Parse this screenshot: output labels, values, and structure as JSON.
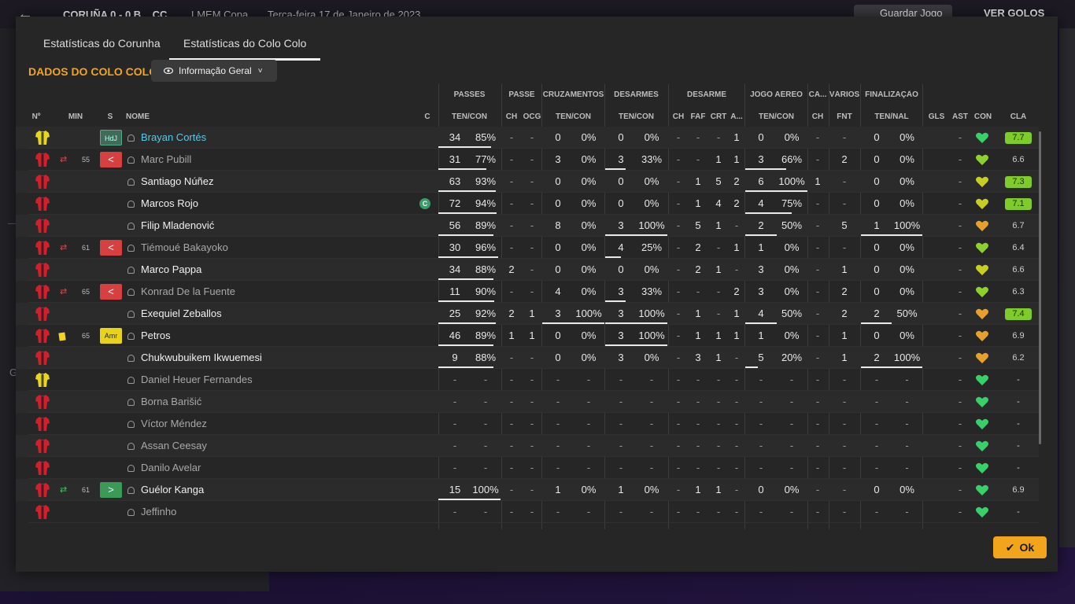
{
  "background": {
    "back_glyph": "←",
    "score_text": "CORUÑA 0 - 0 B... CC",
    "competition": "LMEM Copa",
    "date": "Terça-feira 17 de Janeiro de 2023",
    "save_button": "Guardar Jogo",
    "watch_button": "VER GOLOS",
    "side_letter": "G"
  },
  "tabs": [
    "Estatísticas do Corunha",
    "Estatísticas do Colo Colo"
  ],
  "active_tab": 1,
  "team_title": "DADOS DO COLO COLO",
  "view_dropdown": {
    "label": "Informação Geral",
    "icon": "eye-icon"
  },
  "group_headers": {
    "passes": "PASSES",
    "passe": "PASSE",
    "cruzamentos": "CRUZAMENTOS",
    "desarmes": "DESARMES",
    "desarme": "DESARME",
    "jogo_aereo": "JOGO AÉREO",
    "ca": "CA...",
    "varios": "VÁRIOS",
    "finalizacao": "FINALIZAÇÃO"
  },
  "column_headers": {
    "num": "Nº",
    "min": "MIN",
    "s": "S",
    "nome": "NOME",
    "c": "C",
    "passes": "TEN/CON",
    "passe_ch": "CH",
    "passe_ocg": "OCG",
    "cruz": "TEN/CON",
    "des": "TEN/CON",
    "desarme_ch": "CH",
    "desarme_faf": "FAF",
    "desarme_crt": "CRT",
    "desarme_a": "A...",
    "aereo": "TEN/CON",
    "ca_ch": "CH",
    "varios_fnt": "FNT",
    "fin": "TEN/NAL",
    "gls": "GLS",
    "ast": "AST",
    "con": "CON",
    "cla": "CLA"
  },
  "players": [
    {
      "name": "Brayan Cortés",
      "shirt": "yellow",
      "min": "",
      "sub": "",
      "badge": "HdJ",
      "captain": false,
      "highlight": true,
      "faded": false,
      "passes": [
        "34",
        "85%"
      ],
      "pp": 0.85,
      "passe": [
        "-",
        "-"
      ],
      "cruz": [
        "0",
        "0%"
      ],
      "cp": 0,
      "des": [
        "0",
        "0%"
      ],
      "dp": 0,
      "desarme": [
        "-",
        "-",
        "-",
        "1"
      ],
      "aereo": [
        "0",
        "0%"
      ],
      "ap": 0,
      "ca": "-",
      "fnt": "-",
      "fin": [
        "0",
        "0%"
      ],
      "fp": 0,
      "gls": "",
      "ast": "-",
      "con": "green",
      "cla": "7.7",
      "cla_good": true
    },
    {
      "name": "Marc Pubill",
      "shirt": "red",
      "min": "55",
      "sub": "out",
      "badge": "out",
      "captain": false,
      "highlight": false,
      "faded": true,
      "passes": [
        "31",
        "77%"
      ],
      "pp": 0.77,
      "passe": [
        "-",
        "-"
      ],
      "cruz": [
        "3",
        "0%"
      ],
      "cp": 0,
      "des": [
        "3",
        "33%"
      ],
      "dp": 0.33,
      "desarme": [
        "-",
        "-",
        "1",
        "1"
      ],
      "aereo": [
        "3",
        "66%"
      ],
      "ap": 0.66,
      "ca": "-",
      "fnt": "2",
      "fin": [
        "0",
        "0%"
      ],
      "fp": 0,
      "gls": "",
      "ast": "-",
      "con": "lime",
      "cla": "6.6",
      "cla_good": false
    },
    {
      "name": "Santiago Núñez",
      "shirt": "red",
      "min": "",
      "sub": "",
      "badge": "",
      "captain": false,
      "highlight": false,
      "faded": false,
      "passes": [
        "63",
        "93%"
      ],
      "pp": 0.93,
      "passe": [
        "-",
        "-"
      ],
      "cruz": [
        "0",
        "0%"
      ],
      "cp": 0,
      "des": [
        "0",
        "0%"
      ],
      "dp": 0,
      "desarme": [
        "-",
        "1",
        "5",
        "2"
      ],
      "aereo": [
        "6",
        "100%"
      ],
      "ap": 1,
      "ca": "1",
      "fnt": "-",
      "fin": [
        "0",
        "0%"
      ],
      "fp": 0,
      "gls": "",
      "ast": "-",
      "con": "yellowgreen",
      "cla": "7.3",
      "cla_good": true
    },
    {
      "name": "Marcos Rojo",
      "shirt": "red",
      "min": "",
      "sub": "",
      "badge": "",
      "captain": true,
      "highlight": false,
      "faded": false,
      "passes": [
        "72",
        "94%"
      ],
      "pp": 0.94,
      "passe": [
        "-",
        "-"
      ],
      "cruz": [
        "0",
        "0%"
      ],
      "cp": 0,
      "des": [
        "0",
        "0%"
      ],
      "dp": 0,
      "desarme": [
        "-",
        "1",
        "4",
        "2"
      ],
      "aereo": [
        "4",
        "75%"
      ],
      "ap": 0.75,
      "ca": "-",
      "fnt": "-",
      "fin": [
        "0",
        "0%"
      ],
      "fp": 0,
      "gls": "",
      "ast": "-",
      "con": "yellowgreen",
      "cla": "7.1",
      "cla_good": true
    },
    {
      "name": "Filip Mladenović",
      "shirt": "red",
      "min": "",
      "sub": "",
      "badge": "",
      "captain": false,
      "highlight": false,
      "faded": false,
      "passes": [
        "56",
        "89%"
      ],
      "pp": 0.89,
      "passe": [
        "-",
        "-"
      ],
      "cruz": [
        "8",
        "0%"
      ],
      "cp": 0,
      "des": [
        "3",
        "100%"
      ],
      "dp": 1,
      "desarme": [
        "-",
        "5",
        "1",
        "-"
      ],
      "aereo": [
        "2",
        "50%"
      ],
      "ap": 0.5,
      "ca": "-",
      "fnt": "5",
      "fin": [
        "1",
        "100%"
      ],
      "fp": 1,
      "gls": "",
      "ast": "-",
      "con": "orange",
      "cla": "6.7",
      "cla_good": false
    },
    {
      "name": "Tiémoué Bakayoko",
      "shirt": "red",
      "min": "61",
      "sub": "out",
      "badge": "out",
      "captain": false,
      "highlight": false,
      "faded": true,
      "passes": [
        "30",
        "96%"
      ],
      "pp": 0.96,
      "passe": [
        "-",
        "-"
      ],
      "cruz": [
        "0",
        "0%"
      ],
      "cp": 0,
      "des": [
        "4",
        "25%"
      ],
      "dp": 0.25,
      "desarme": [
        "-",
        "2",
        "-",
        "1"
      ],
      "aereo": [
        "1",
        "0%"
      ],
      "ap": 0,
      "ca": "-",
      "fnt": "-",
      "fin": [
        "0",
        "0%"
      ],
      "fp": 0,
      "gls": "",
      "ast": "-",
      "con": "lime",
      "cla": "6.4",
      "cla_good": false
    },
    {
      "name": "Marco Pappa",
      "shirt": "red",
      "min": "",
      "sub": "",
      "badge": "",
      "captain": false,
      "highlight": false,
      "faded": false,
      "passes": [
        "34",
        "88%"
      ],
      "pp": 0.88,
      "passe": [
        "2",
        "-"
      ],
      "cruz": [
        "0",
        "0%"
      ],
      "cp": 0,
      "des": [
        "0",
        "0%"
      ],
      "dp": 0,
      "desarme": [
        "-",
        "2",
        "1",
        "-"
      ],
      "aereo": [
        "3",
        "0%"
      ],
      "ap": 0,
      "ca": "-",
      "fnt": "1",
      "fin": [
        "0",
        "0%"
      ],
      "fp": 0,
      "gls": "",
      "ast": "-",
      "con": "yellowgreen",
      "cla": "6.6",
      "cla_good": false
    },
    {
      "name": "Konrad De la Fuente",
      "shirt": "red",
      "min": "65",
      "sub": "out",
      "badge": "out",
      "captain": false,
      "highlight": false,
      "faded": true,
      "passes": [
        "11",
        "90%"
      ],
      "pp": 0.9,
      "passe": [
        "-",
        "-"
      ],
      "cruz": [
        "4",
        "0%"
      ],
      "cp": 0,
      "des": [
        "3",
        "33%"
      ],
      "dp": 0.33,
      "desarme": [
        "-",
        "-",
        "-",
        "2"
      ],
      "aereo": [
        "3",
        "0%"
      ],
      "ap": 0,
      "ca": "-",
      "fnt": "2",
      "fin": [
        "0",
        "0%"
      ],
      "fp": 0,
      "gls": "",
      "ast": "-",
      "con": "lime",
      "cla": "6.3",
      "cla_good": false
    },
    {
      "name": "Exequiel Zeballos",
      "shirt": "red",
      "min": "",
      "sub": "",
      "badge": "",
      "captain": false,
      "highlight": false,
      "faded": false,
      "passes": [
        "25",
        "92%"
      ],
      "pp": 0.92,
      "passe": [
        "2",
        "1"
      ],
      "cruz": [
        "3",
        "100%"
      ],
      "cp": 1,
      "des": [
        "3",
        "100%"
      ],
      "dp": 1,
      "desarme": [
        "-",
        "1",
        "-",
        "1"
      ],
      "aereo": [
        "4",
        "50%"
      ],
      "ap": 0.5,
      "ca": "-",
      "fnt": "2",
      "fin": [
        "2",
        "50%"
      ],
      "fp": 0.5,
      "gls": "",
      "ast": "-",
      "con": "orange",
      "cla": "7.4",
      "cla_good": true
    },
    {
      "name": "Petros",
      "shirt": "red",
      "min": "65",
      "sub": "yellow",
      "badge": "Amr",
      "captain": false,
      "highlight": false,
      "faded": false,
      "passes": [
        "46",
        "89%"
      ],
      "pp": 0.89,
      "passe": [
        "1",
        "1"
      ],
      "cruz": [
        "0",
        "0%"
      ],
      "cp": 0,
      "des": [
        "3",
        "100%"
      ],
      "dp": 1,
      "desarme": [
        "-",
        "1",
        "1",
        "1"
      ],
      "aereo": [
        "1",
        "0%"
      ],
      "ap": 0,
      "ca": "-",
      "fnt": "1",
      "fin": [
        "0",
        "0%"
      ],
      "fp": 0,
      "gls": "",
      "ast": "-",
      "con": "orange",
      "cla": "6.9",
      "cla_good": false
    },
    {
      "name": "Chukwubuikem Ikwuemesi",
      "shirt": "red",
      "min": "",
      "sub": "",
      "badge": "",
      "captain": false,
      "highlight": false,
      "faded": false,
      "passes": [
        "9",
        "88%"
      ],
      "pp": 0.88,
      "passe": [
        "-",
        "-"
      ],
      "cruz": [
        "0",
        "0%"
      ],
      "cp": 0,
      "des": [
        "3",
        "0%"
      ],
      "dp": 0,
      "desarme": [
        "-",
        "3",
        "1",
        "-"
      ],
      "aereo": [
        "5",
        "20%"
      ],
      "ap": 0.2,
      "ca": "-",
      "fnt": "1",
      "fin": [
        "2",
        "100%"
      ],
      "fp": 1,
      "gls": "",
      "ast": "-",
      "con": "orange",
      "cla": "6.2",
      "cla_good": false
    },
    {
      "name": "Daniel Heuer Fernandes",
      "shirt": "yellow",
      "min": "",
      "sub": "",
      "badge": "",
      "captain": false,
      "highlight": false,
      "faded": true,
      "passes": [
        "-",
        "-"
      ],
      "pp": null,
      "passe": [
        "-",
        "-"
      ],
      "cruz": [
        "-",
        "-"
      ],
      "cp": null,
      "des": [
        "-",
        "-"
      ],
      "dp": null,
      "desarme": [
        "-",
        "-",
        "-",
        "-"
      ],
      "aereo": [
        "-",
        "-"
      ],
      "ap": null,
      "ca": "-",
      "fnt": "-",
      "fin": [
        "-",
        "-"
      ],
      "fp": null,
      "gls": "",
      "ast": "-",
      "con": "green",
      "cla": "-",
      "cla_good": false
    },
    {
      "name": "Borna Barišić",
      "shirt": "red",
      "min": "",
      "sub": "",
      "badge": "",
      "captain": false,
      "highlight": false,
      "faded": true,
      "passes": [
        "-",
        "-"
      ],
      "pp": null,
      "passe": [
        "-",
        "-"
      ],
      "cruz": [
        "-",
        "-"
      ],
      "cp": null,
      "des": [
        "-",
        "-"
      ],
      "dp": null,
      "desarme": [
        "-",
        "-",
        "-",
        "-"
      ],
      "aereo": [
        "-",
        "-"
      ],
      "ap": null,
      "ca": "-",
      "fnt": "-",
      "fin": [
        "-",
        "-"
      ],
      "fp": null,
      "gls": "",
      "ast": "-",
      "con": "green",
      "cla": "-",
      "cla_good": false
    },
    {
      "name": "Víctor Méndez",
      "shirt": "red",
      "min": "",
      "sub": "",
      "badge": "",
      "captain": false,
      "highlight": false,
      "faded": true,
      "passes": [
        "-",
        "-"
      ],
      "pp": null,
      "passe": [
        "-",
        "-"
      ],
      "cruz": [
        "-",
        "-"
      ],
      "cp": null,
      "des": [
        "-",
        "-"
      ],
      "dp": null,
      "desarme": [
        "-",
        "-",
        "-",
        "-"
      ],
      "aereo": [
        "-",
        "-"
      ],
      "ap": null,
      "ca": "-",
      "fnt": "-",
      "fin": [
        "-",
        "-"
      ],
      "fp": null,
      "gls": "",
      "ast": "-",
      "con": "green",
      "cla": "-",
      "cla_good": false
    },
    {
      "name": "Assan Ceesay",
      "shirt": "red",
      "min": "",
      "sub": "",
      "badge": "",
      "captain": false,
      "highlight": false,
      "faded": true,
      "passes": [
        "-",
        "-"
      ],
      "pp": null,
      "passe": [
        "-",
        "-"
      ],
      "cruz": [
        "-",
        "-"
      ],
      "cp": null,
      "des": [
        "-",
        "-"
      ],
      "dp": null,
      "desarme": [
        "-",
        "-",
        "-",
        "-"
      ],
      "aereo": [
        "-",
        "-"
      ],
      "ap": null,
      "ca": "-",
      "fnt": "-",
      "fin": [
        "-",
        "-"
      ],
      "fp": null,
      "gls": "",
      "ast": "-",
      "con": "green",
      "cla": "-",
      "cla_good": false
    },
    {
      "name": "Danilo Avelar",
      "shirt": "red",
      "min": "",
      "sub": "",
      "badge": "",
      "captain": false,
      "highlight": false,
      "faded": true,
      "passes": [
        "-",
        "-"
      ],
      "pp": null,
      "passe": [
        "-",
        "-"
      ],
      "cruz": [
        "-",
        "-"
      ],
      "cp": null,
      "des": [
        "-",
        "-"
      ],
      "dp": null,
      "desarme": [
        "-",
        "-",
        "-",
        "-"
      ],
      "aereo": [
        "-",
        "-"
      ],
      "ap": null,
      "ca": "-",
      "fnt": "-",
      "fin": [
        "-",
        "-"
      ],
      "fp": null,
      "gls": "",
      "ast": "-",
      "con": "green",
      "cla": "-",
      "cla_good": false
    },
    {
      "name": "Guélor Kanga",
      "shirt": "red",
      "min": "61",
      "sub": "in",
      "badge": "in",
      "captain": false,
      "highlight": false,
      "faded": false,
      "passes": [
        "15",
        "100%"
      ],
      "pp": 1,
      "passe": [
        "-",
        "-"
      ],
      "cruz": [
        "1",
        "0%"
      ],
      "cp": 0,
      "des": [
        "1",
        "0%"
      ],
      "dp": 0,
      "desarme": [
        "-",
        "1",
        "1",
        "-"
      ],
      "aereo": [
        "0",
        "0%"
      ],
      "ap": 0,
      "ca": "-",
      "fnt": "-",
      "fin": [
        "0",
        "0%"
      ],
      "fp": 0,
      "gls": "",
      "ast": "-",
      "con": "green",
      "cla": "6.9",
      "cla_good": false
    },
    {
      "name": "Jeffinho",
      "shirt": "red",
      "min": "",
      "sub": "",
      "badge": "",
      "captain": false,
      "highlight": false,
      "faded": true,
      "passes": [
        "-",
        "-"
      ],
      "pp": null,
      "passe": [
        "-",
        "-"
      ],
      "cruz": [
        "-",
        "-"
      ],
      "cp": null,
      "des": [
        "-",
        "-"
      ],
      "dp": null,
      "desarme": [
        "-",
        "-",
        "-",
        "-"
      ],
      "aereo": [
        "-",
        "-"
      ],
      "ap": null,
      "ca": "-",
      "fnt": "-",
      "fin": [
        "-",
        "-"
      ],
      "fp": null,
      "gls": "",
      "ast": "-",
      "con": "green",
      "cla": "-",
      "cla_good": false
    }
  ],
  "captain_glyph": "C",
  "sub_out_glyph": "<",
  "sub_in_glyph": ">",
  "colors": {
    "accent": "#f2a51c",
    "link": "#5cc8e8",
    "rating_good": "#7ecb2a",
    "sub_out": "#d64040",
    "sub_in": "#3a9a56"
  },
  "ok_button": {
    "label": "Ok",
    "icon": "check-icon"
  }
}
